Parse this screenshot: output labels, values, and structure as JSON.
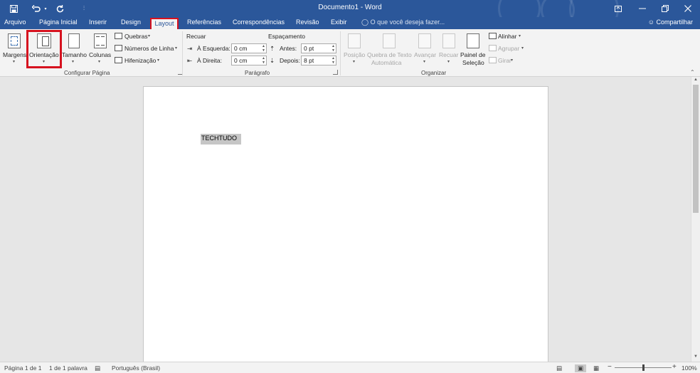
{
  "app": {
    "title": "Documento1 - Word",
    "share_label": "Compartilhar",
    "tell_me_placeholder": "O que você deseja fazer..."
  },
  "qat": {
    "save_icon": "floppy-disk-icon",
    "undo_icon": "undo-arrow-icon",
    "redo_icon": "redo-arrow-icon",
    "customize_icon": "customize-qat-icon"
  },
  "tabs": [
    {
      "label": "Arquivo"
    },
    {
      "label": "Página Inicial"
    },
    {
      "label": "Inserir"
    },
    {
      "label": "Design"
    },
    {
      "label": "Layout"
    },
    {
      "label": "Referências"
    },
    {
      "label": "Correspondências"
    },
    {
      "label": "Revisão"
    },
    {
      "label": "Exibir"
    }
  ],
  "ribbon": {
    "configurar": {
      "margens": "Margens",
      "orientacao": "Orientação",
      "tamanho": "Tamanho",
      "colunas": "Colunas",
      "quebras": "Quebras",
      "numeros_linha": "Números de Linha",
      "hifenizacao": "Hifenização",
      "group_label": "Configurar Página"
    },
    "paragrafo": {
      "recuar": "Recuar",
      "espacamento": "Espaçamento",
      "esquerda_label": "À Esquerda:",
      "esquerda_value": "0 cm",
      "direita_label": "À Direita:",
      "direita_value": "0 cm",
      "antes_label": "Antes:",
      "antes_value": "0 pt",
      "depois_label": "Depois:",
      "depois_value": "8 pt",
      "group_label": "Parágrafo"
    },
    "organizar": {
      "posicao": "Posição",
      "quebra_texto_1": "Quebra de Texto",
      "quebra_texto_2": "Automática",
      "avancar": "Avançar",
      "recuar": "Recuar",
      "painel_1": "Painel de",
      "painel_2": "Seleção",
      "alinhar": "Alinhar",
      "agrupar": "Agrupar",
      "girar": "Girar",
      "group_label": "Organizar"
    }
  },
  "document": {
    "text": "TECHTUDO"
  },
  "status": {
    "page": "Página 1 de 1",
    "words": "1 de 1 palavra",
    "language": "Português (Brasil)",
    "zoom": "100%"
  }
}
